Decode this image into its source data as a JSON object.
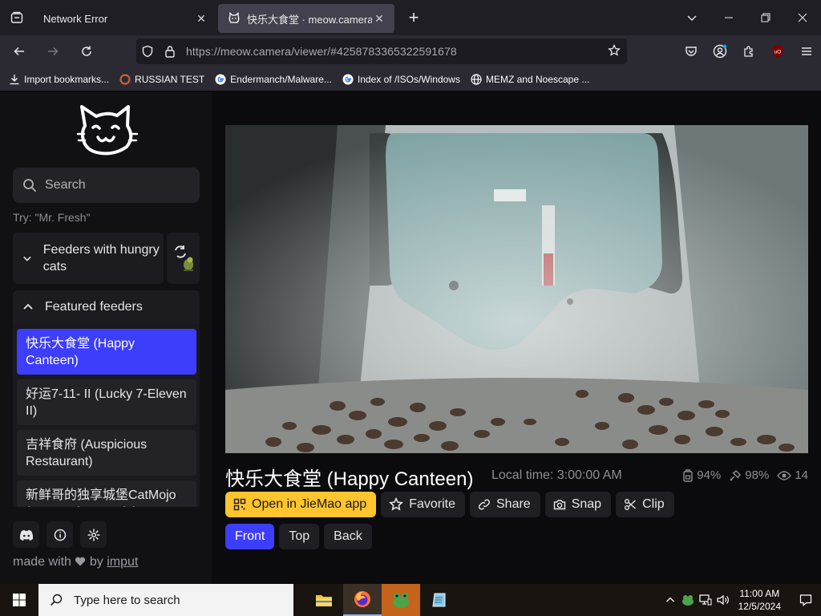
{
  "browser": {
    "tabs": [
      {
        "title": "Network Error",
        "active": false
      },
      {
        "title": "快乐大食堂 · meow.camera",
        "active": true
      }
    ],
    "url": "https://meow.camera/viewer/#4258783365322591678",
    "bookmarks": [
      {
        "label": "Import bookmarks...",
        "icon": "import-icon"
      },
      {
        "label": "RUSSIAN TEST",
        "icon": "ring-icon"
      },
      {
        "label": "Endermanch/Malware...",
        "icon": "google-icon"
      },
      {
        "label": "Index of /ISOs/Windows",
        "icon": "google-icon"
      },
      {
        "label": "MEMZ and Noescape ...",
        "icon": "globe-icon"
      }
    ]
  },
  "sidebar": {
    "search_placeholder": "Search",
    "hint": "Try: \"Mr. Fresh\"",
    "hungry_section": "Feeders with hungry cats",
    "featured_section": "Featured feeders",
    "feeders": [
      {
        "name": "快乐大食堂 (Happy Canteen)",
        "selected": true
      },
      {
        "name": "好运7-11- II  (Lucky 7-Eleven II)",
        "selected": false
      },
      {
        "name": "吉祥食府 (Auspicious Restaurant)",
        "selected": false
      },
      {
        "name": "新鲜哥的独享城堡CatMojo (Mr. Fresh's Castle)",
        "selected": false
      }
    ],
    "footer": {
      "made_with": "made with",
      "by": "by",
      "author": "imput"
    }
  },
  "viewer": {
    "title": "快乐大食堂 (Happy Canteen)",
    "local_time": "Local time: 3:00:00 AM",
    "stats": {
      "food": "94%",
      "battery": "98%",
      "viewers": "14"
    },
    "actions": [
      "Open in JieMao app",
      "Favorite",
      "Share",
      "Snap",
      "Clip"
    ],
    "views": [
      "Front",
      "Top",
      "Back"
    ],
    "active_view": "Front"
  },
  "taskbar": {
    "search_placeholder": "Type here to search",
    "time": "11:00 AM",
    "date": "12/5/2024"
  },
  "colors": {
    "accent": "#3d3dfc",
    "primary_button": "#ffc42e"
  }
}
